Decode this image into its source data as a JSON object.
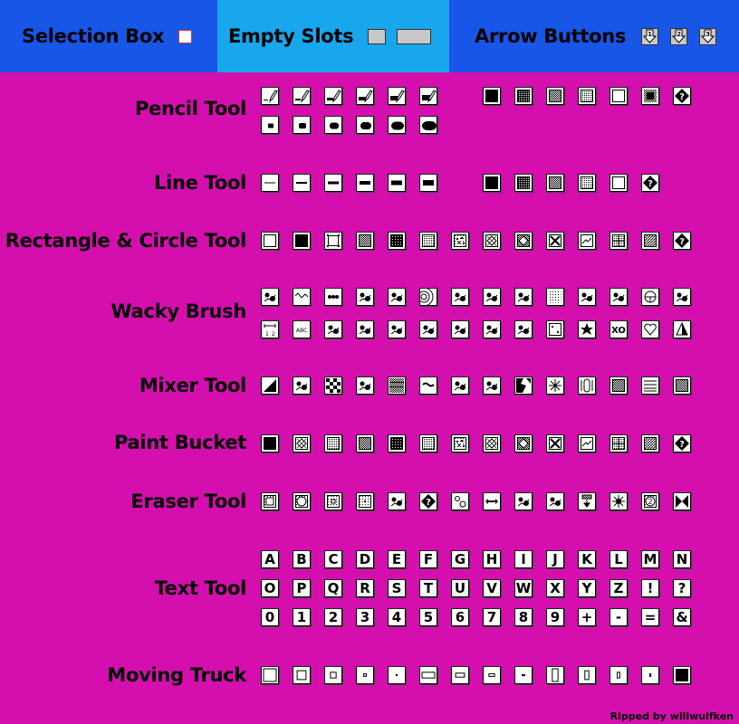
{
  "colors": {
    "background": "#d40fad",
    "header_dark": "#1856e8",
    "header_light": "#18a6ec",
    "selection_border": "#e0303a",
    "slot_gray": "#c8c8c8"
  },
  "header": {
    "selection_box": {
      "label": "Selection Box"
    },
    "empty_slots": {
      "label": "Empty Slots"
    },
    "arrow_buttons": {
      "label": "Arrow Buttons",
      "buttons": [
        "1",
        "2",
        "3"
      ]
    }
  },
  "rows": [
    {
      "label": "Pencil Tool",
      "lines": [
        [
          "pencil-size-1",
          "pencil-size-2",
          "pencil-size-3",
          "pencil-size-4",
          "pencil-size-5",
          "pencil-size-6",
          null,
          "fill-solid",
          "fill-dense",
          "fill-checker",
          "fill-light",
          "fill-empty",
          "fill-spray",
          "random"
        ],
        [
          "dot-size-1",
          "dot-size-2",
          "dot-size-3",
          "dot-size-4",
          "dot-size-5",
          "dot-size-6"
        ]
      ]
    },
    {
      "label": "Line Tool",
      "lines": [
        [
          "line-size-1",
          "line-size-2",
          "line-size-3",
          "line-size-4",
          "line-size-5",
          "line-size-6",
          null,
          "fill-solid",
          "fill-dense",
          "fill-checker",
          "fill-light",
          "fill-empty",
          "random"
        ]
      ]
    },
    {
      "label": "Rectangle & Circle Tool",
      "lines": [
        [
          "shape-empty",
          "shape-filled",
          "shape-dotted-corners",
          "pattern-checker",
          "pattern-dark-dots",
          "pattern-light-dots",
          "pattern-blobs",
          "pattern-diamond",
          "pattern-dark-diamond",
          "pattern-arrows",
          "pattern-zigzag",
          "pattern-grid",
          "pattern-diagonal",
          "random"
        ]
      ]
    },
    {
      "label": "Wacky Brush",
      "lines": [
        [
          "wacky-blob",
          "wacky-zigzag",
          "wacky-chain",
          "wacky-scatter",
          "wacky-splat",
          "wacky-rings",
          "wacky-bars",
          "wacky-box",
          "wacky-tree-box",
          "wacky-spray",
          "wacky-branch",
          "wacky-stroke",
          "wacky-wheel",
          "wacky-drips"
        ],
        [
          "wacky-ruler",
          "wacky-abc",
          "wacky-rays",
          "wacky-shoe",
          "wacky-ball",
          "wacky-tree",
          "wacky-swirl",
          "wacky-spots",
          "wacky-loops",
          "wacky-dice",
          "wacky-star",
          "wacky-xo",
          "wacky-heart",
          "wacky-triangle"
        ]
      ]
    },
    {
      "label": "Mixer Tool",
      "lines": [
        [
          "mix-diagonal",
          "mix-swirl",
          "mix-checker",
          "mix-chains",
          "mix-stripes",
          "mix-wave",
          "mix-drop",
          "mix-arch",
          "mix-shatter",
          "mix-burst",
          "mix-clip",
          "mix-noise",
          "mix-bands",
          "mix-dots"
        ]
      ]
    },
    {
      "label": "Paint Bucket",
      "lines": [
        [
          "fill-solid",
          "pattern-diamond",
          "pattern-dotted",
          "pattern-checker",
          "pattern-dark-dots",
          "pattern-light-dots",
          "pattern-blobs",
          "pattern-diamond",
          "pattern-dark-diamond",
          "pattern-arrows",
          "pattern-zigzag",
          "pattern-grid",
          "pattern-diagonal",
          "random"
        ]
      ]
    },
    {
      "label": "Eraser Tool",
      "lines": [
        [
          "erase-square",
          "erase-circle",
          "erase-small-square",
          "erase-dot",
          "erase-firecracker",
          "random",
          "erase-bubbles",
          "erase-arrows",
          "erase-letters",
          "erase-people",
          "erase-drop",
          "erase-implode",
          "erase-countdown",
          "erase-hourglass"
        ]
      ]
    },
    {
      "label": "Text Tool",
      "lines": [
        [
          "A",
          "B",
          "C",
          "D",
          "E",
          "F",
          "G",
          "H",
          "I",
          "J",
          "K",
          "L",
          "M",
          "N"
        ],
        [
          "O",
          "P",
          "Q",
          "R",
          "S",
          "T",
          "U",
          "V",
          "W",
          "X",
          "Y",
          "Z",
          "!",
          "?"
        ],
        [
          "0",
          "1",
          "2",
          "3",
          "4",
          "5",
          "6",
          "7",
          "8",
          "9",
          "+",
          "-",
          "=",
          "&"
        ]
      ]
    },
    {
      "label": "Moving Truck",
      "lines": [
        [
          "sq-xl",
          "sq-l",
          "sq-m",
          "sq-s",
          "sq-xs",
          "wide-xl",
          "wide-l",
          "wide-m",
          "wide-s",
          "tall-xl",
          "tall-l",
          "tall-m",
          "tall-s",
          "magnet"
        ]
      ]
    }
  ],
  "credit": "Ripped by willwulfken"
}
